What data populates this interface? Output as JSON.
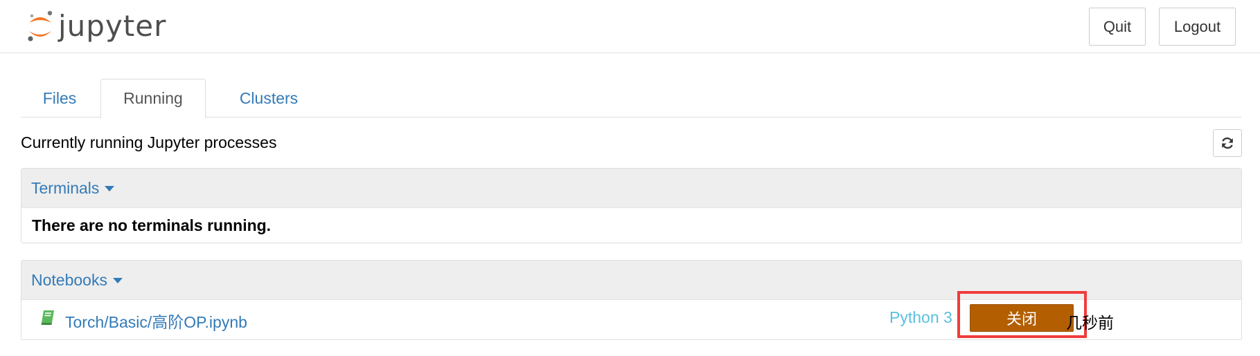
{
  "header": {
    "logo_text": "jupyter",
    "quit_label": "Quit",
    "logout_label": "Logout"
  },
  "tabs": [
    {
      "label": "Files"
    },
    {
      "label": "Running"
    },
    {
      "label": "Clusters"
    }
  ],
  "running": {
    "subtitle": "Currently running Jupyter processes",
    "refresh_icon": "refresh-icon"
  },
  "terminals": {
    "title": "Terminals",
    "empty_message": "There are no terminals running."
  },
  "notebooks": {
    "title": "Notebooks",
    "items": [
      {
        "path": "Torch/Basic/高阶OP.ipynb",
        "kernel": "Python 3",
        "shutdown_label": "关闭",
        "last_activity": "几秒前"
      }
    ]
  },
  "colors": {
    "link": "#337ab7",
    "kernel": "#5bc0de",
    "shutdown_button": "#b35e00",
    "highlight_border": "#f03c3c",
    "logo_orange": "#f37726"
  }
}
